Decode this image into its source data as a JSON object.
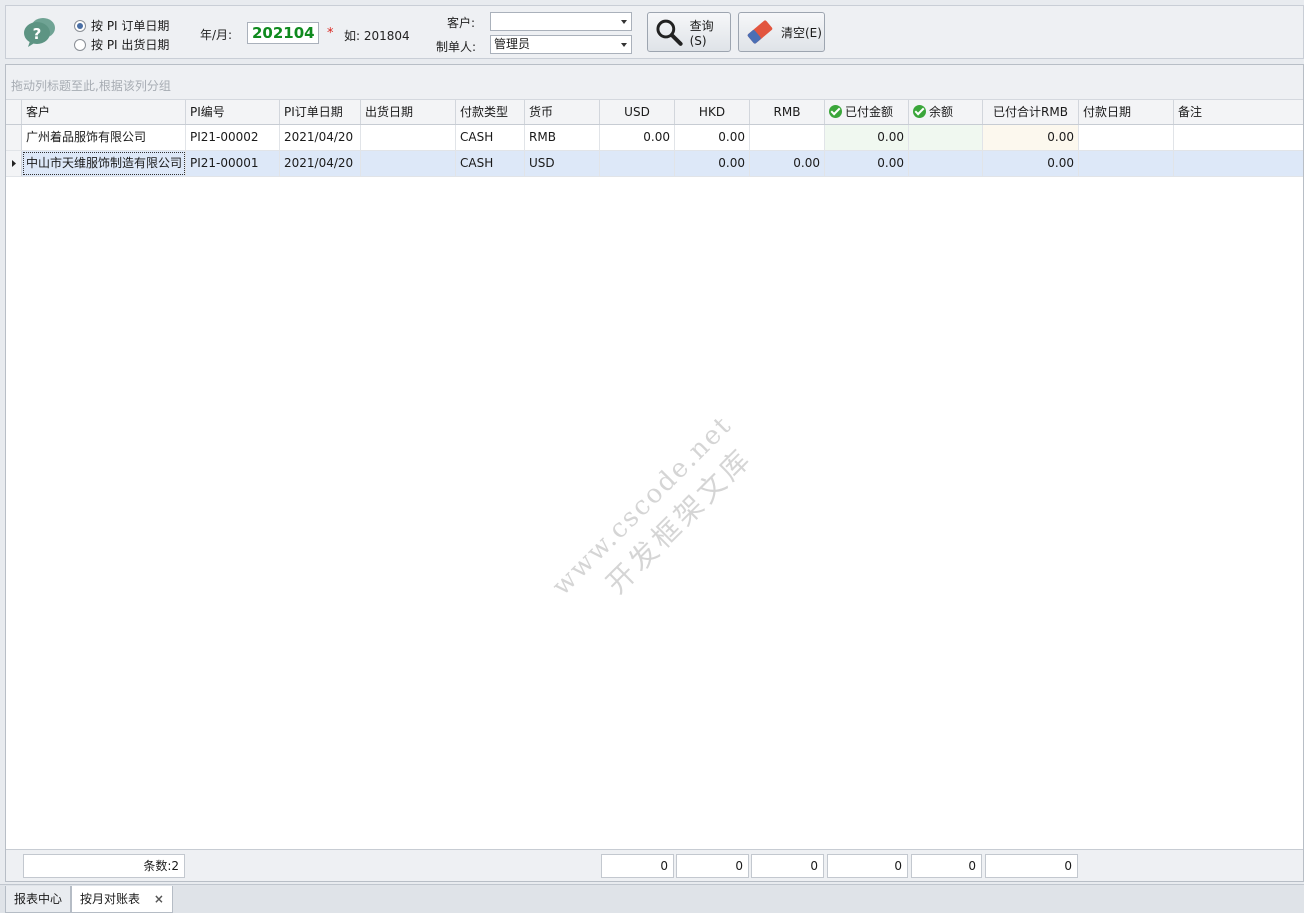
{
  "toolbar": {
    "radio_order_date": "按 PI 订单日期",
    "radio_ship_date": "按 PI 出货日期",
    "ym_label": "年/月:",
    "ym_value": "202104",
    "required_mark": "*",
    "example": "如: 201804",
    "customer_label": "客户:",
    "customer_value": "",
    "creator_label": "制单人:",
    "creator_value": "管理员",
    "query_label": "查询(S)",
    "clear_label": "清空(E)"
  },
  "grid": {
    "group_hint": "拖动列标题至此,根据该列分组",
    "columns": [
      "客户",
      "PI编号",
      "PI订单日期",
      "出货日期",
      "付款类型",
      "货币",
      "USD",
      "HKD",
      "RMB",
      "已付金额",
      "余额",
      "已付合计RMB",
      "付款日期",
      "备注"
    ],
    "rows": [
      [
        "广州着品服饰有限公司",
        "PI21-00002",
        "2021/04/20",
        "",
        "CASH",
        "RMB",
        "0.00",
        "0.00",
        "",
        "0.00",
        "",
        "0.00",
        "",
        ""
      ],
      [
        "中山市天维服饰制造有限公司",
        "PI21-00001",
        "2021/04/20",
        "",
        "CASH",
        "USD",
        "",
        "0.00",
        "0.00",
        "0.00",
        "",
        "0.00",
        "",
        ""
      ]
    ],
    "footer": {
      "count": "条数:2",
      "usd": "0",
      "hkd": "0",
      "rmb": "0",
      "paid": "0",
      "balance": "0",
      "paid_rmb": "0"
    }
  },
  "watermark": {
    "line1": "www.cscode.net",
    "line2": "开发框架文库"
  },
  "tabs": [
    {
      "label": "报表中心"
    },
    {
      "label": "按月对账表",
      "close": "×"
    }
  ],
  "colors": {
    "accent_green": "#0f8a1e",
    "selected_row": "#dde8f8",
    "required": "#d9221b"
  }
}
